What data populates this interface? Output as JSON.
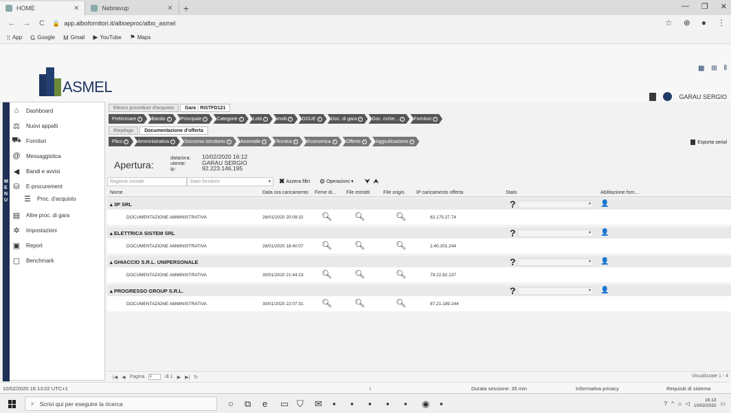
{
  "browser": {
    "tabs": [
      {
        "label": "HOME",
        "active": true
      },
      {
        "label": "Nebravup",
        "active": false
      }
    ],
    "url": "app.albofornitori.it/alboeproc/albo_asmel",
    "bookmarks": [
      "App",
      "Google",
      "Gmail",
      "YouTube",
      "Maps"
    ]
  },
  "header": {
    "logo_text": "ASMEL",
    "user_name": "GARAU SERGIO"
  },
  "sidebar": {
    "menu_label": [
      "M",
      "E",
      "N",
      "U"
    ],
    "items": [
      {
        "label": "Dashboard",
        "icon": "home-icon"
      },
      {
        "label": "Nuovi appalti",
        "icon": "scale-icon"
      },
      {
        "label": "Fornitori",
        "icon": "truck-icon"
      },
      {
        "label": "Messaggistica",
        "icon": "at-icon"
      },
      {
        "label": "Bandi e avvisi",
        "icon": "megaphone-icon"
      },
      {
        "label": "E-procurement",
        "icon": "cart-icon"
      },
      {
        "label": "Proc. d'acquisto",
        "icon": "list-icon"
      },
      {
        "label": "Altre proc. di gara",
        "icon": "book-icon"
      },
      {
        "label": "Impostazioni",
        "icon": "gear-icon"
      },
      {
        "label": "Report",
        "icon": "chart-icon"
      },
      {
        "label": "Benchmark",
        "icon": "doc-icon"
      }
    ]
  },
  "main": {
    "outer_tabs": [
      "Elenco procedure d'acquisto",
      "Gara : RISTFD121"
    ],
    "gara_steps": [
      "Preliminare",
      "Bando",
      "Principale",
      "Categorie",
      "Lotti",
      "Inviti",
      "DGUE",
      "Doc. di gara",
      "Doc. richie...",
      "Fornitori"
    ],
    "inner_tabs": [
      "Riepilogo",
      "Documentazione d'offerta"
    ],
    "offer_steps": [
      "Plico",
      "Amministrativa",
      "Soccorso istruttorio",
      "Anomalie",
      "Tecnica",
      "Economica",
      "Offerte",
      "Aggiudicazione"
    ],
    "export_label": "Esporta serial",
    "apertura": {
      "label": "Apertura:",
      "keys": [
        "data/ora:",
        "utente:",
        "ip:"
      ],
      "values": [
        "10/02/2020 16:12",
        "GARAU SERGIO",
        "92.223.146.195"
      ]
    },
    "filters": {
      "ragione_placeholder": "Ragione sociale",
      "stato_placeholder": "Stato fornitore",
      "reset_label": "Azzera filtri",
      "operazioni_label": "Operazioni"
    },
    "columns": [
      "Nome",
      "Data ora caricamento",
      "Firme di...",
      "File estratti",
      "File origin.",
      "IP caricamento offerta",
      "Stato",
      "Abilitazione forn..."
    ],
    "groups": [
      {
        "name": "3P SRL",
        "doc": "DOCUMENTAZIONE AMMINISTRATIVA",
        "datetime": "26/01/2020 20:09:32",
        "ip": "62.175.27.74"
      },
      {
        "name": "ELETTRICA SISTEM SRL",
        "doc": "DOCUMENTAZIONE AMMINISTRATIVA",
        "datetime": "28/01/2020 18:40:07",
        "ip": "2.40.201.244"
      },
      {
        "name": "GHIACCIO S.R.L. UNIPERSONALE",
        "doc": "DOCUMENTAZIONE AMMINISTRATIVA",
        "datetime": "30/01/2020 21:44:23",
        "ip": "79.22.82.137"
      },
      {
        "name": "PROGRESSO GROUP S.R.L.",
        "doc": "DOCUMENTAZIONE AMMINISTRATIVA",
        "datetime": "30/01/2020 22:07:31",
        "ip": "87.21.189.244"
      }
    ],
    "state_symbol": "?",
    "pager": {
      "page_label": "Pagina",
      "page_value": "1",
      "of_label": "di 1",
      "visible_label": "Visualizzate 1 - 4"
    }
  },
  "status": {
    "datetime": "10/02/2020 16:13:02 UTC+1",
    "session": "Durata sessione: 35 min",
    "privacy": "Informativa privacy",
    "requirements": "Requisiti di sistema"
  },
  "taskbar": {
    "search_placeholder": "Scrivi qui per eseguire la ricerca",
    "time": "16:13",
    "date": "10/02/2020"
  }
}
